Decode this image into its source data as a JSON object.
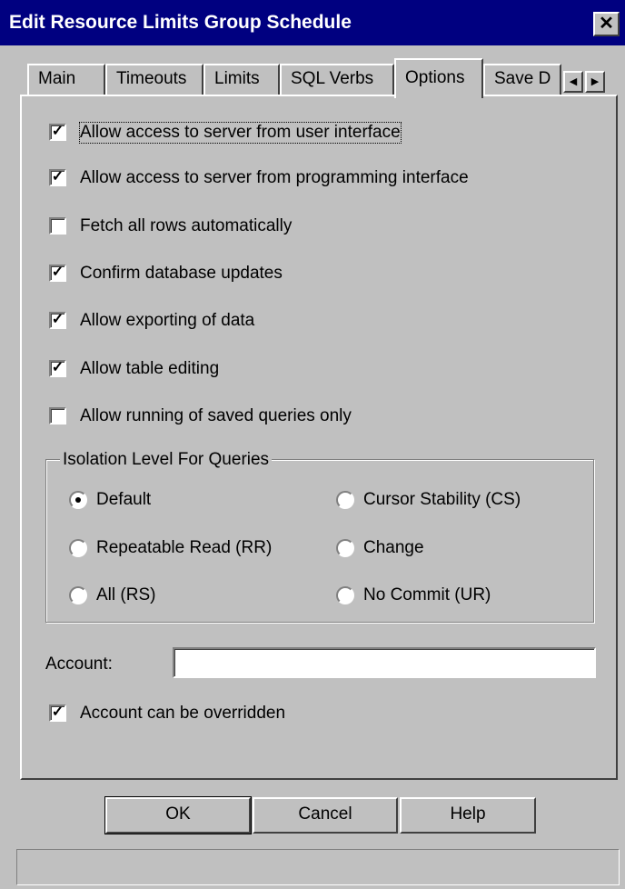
{
  "window": {
    "title": "Edit Resource Limits Group Schedule",
    "close_glyph": "✕"
  },
  "tabs": [
    {
      "label": "Main"
    },
    {
      "label": "Timeouts"
    },
    {
      "label": "Limits"
    },
    {
      "label": "SQL Verbs"
    },
    {
      "label": "Options",
      "active": true
    },
    {
      "label": "Save D"
    }
  ],
  "tab_scroll": {
    "left_glyph": "◀",
    "right_glyph": "▶"
  },
  "options": {
    "check_glyph": "✓",
    "checkboxes": [
      {
        "label": "Allow access to server from user interface",
        "checked": true
      },
      {
        "label": "Allow access to server from programming interface",
        "checked": true
      },
      {
        "label": "Fetch all rows automatically",
        "checked": false
      },
      {
        "label": "Confirm database updates",
        "checked": true
      },
      {
        "label": "Allow exporting of data",
        "checked": true
      },
      {
        "label": "Allow table editing",
        "checked": true
      },
      {
        "label": "Allow running of saved queries only",
        "checked": false
      }
    ]
  },
  "isolation": {
    "title": "Isolation Level For Queries",
    "radios": [
      {
        "label": "Default",
        "selected": true
      },
      {
        "label": "Repeatable Read (RR)",
        "selected": false
      },
      {
        "label": "All (RS)",
        "selected": false
      },
      {
        "label": "Cursor Stability (CS)",
        "selected": false
      },
      {
        "label": "Change",
        "selected": false
      },
      {
        "label": "No Commit (UR)",
        "selected": false
      }
    ]
  },
  "account": {
    "label": "Account:",
    "value": ""
  },
  "account_override": {
    "label": "Account can be overridden",
    "checked": true
  },
  "buttons": {
    "ok": "OK",
    "cancel": "Cancel",
    "help": "Help"
  },
  "status": {
    "text": ""
  }
}
